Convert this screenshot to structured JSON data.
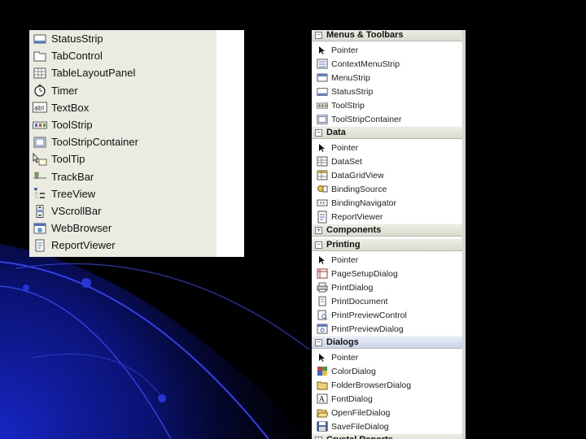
{
  "left_panel": {
    "items": [
      {
        "label": "StatusStrip",
        "icon": "status-strip-icon"
      },
      {
        "label": "TabControl",
        "icon": "tab-control-icon"
      },
      {
        "label": "TableLayoutPanel",
        "icon": "table-layout-panel-icon"
      },
      {
        "label": "Timer",
        "icon": "timer-icon"
      },
      {
        "label": "TextBox",
        "icon": "textbox-icon"
      },
      {
        "label": "ToolStrip",
        "icon": "toolstrip-icon"
      },
      {
        "label": "ToolStripContainer",
        "icon": "toolstrip-container-icon"
      },
      {
        "label": "ToolTip",
        "icon": "tooltip-icon"
      },
      {
        "label": "TrackBar",
        "icon": "trackbar-icon"
      },
      {
        "label": "TreeView",
        "icon": "treeview-icon"
      },
      {
        "label": "VScrollBar",
        "icon": "vscrollbar-icon"
      },
      {
        "label": "WebBrowser",
        "icon": "webbrowser-icon"
      },
      {
        "label": "ReportViewer",
        "icon": "reportviewer-icon"
      }
    ]
  },
  "right_panel": {
    "categories": [
      {
        "label": "Menus & Toolbars",
        "expanded": true,
        "items": [
          {
            "label": "Pointer",
            "icon": "pointer-icon"
          },
          {
            "label": "ContextMenuStrip",
            "icon": "context-menu-strip-icon"
          },
          {
            "label": "MenuStrip",
            "icon": "menu-strip-icon"
          },
          {
            "label": "StatusStrip",
            "icon": "status-strip-icon"
          },
          {
            "label": "ToolStrip",
            "icon": "toolstrip-icon"
          },
          {
            "label": "ToolStripContainer",
            "icon": "toolstrip-container-icon"
          }
        ]
      },
      {
        "label": "Data",
        "expanded": true,
        "items": [
          {
            "label": "Pointer",
            "icon": "pointer-icon"
          },
          {
            "label": "DataSet",
            "icon": "dataset-icon"
          },
          {
            "label": "DataGridView",
            "icon": "datagridview-icon"
          },
          {
            "label": "BindingSource",
            "icon": "binding-source-icon"
          },
          {
            "label": "BindingNavigator",
            "icon": "binding-navigator-icon"
          },
          {
            "label": "ReportViewer",
            "icon": "reportviewer-icon"
          }
        ]
      },
      {
        "label": "Components",
        "expanded": false,
        "items": []
      },
      {
        "label": "Printing",
        "expanded": true,
        "items": [
          {
            "label": "Pointer",
            "icon": "pointer-icon"
          },
          {
            "label": "PageSetupDialog",
            "icon": "page-setup-dialog-icon"
          },
          {
            "label": "PrintDialog",
            "icon": "print-dialog-icon"
          },
          {
            "label": "PrintDocument",
            "icon": "print-document-icon"
          },
          {
            "label": "PrintPreviewControl",
            "icon": "print-preview-control-icon"
          },
          {
            "label": "PrintPreviewDialog",
            "icon": "print-preview-dialog-icon"
          }
        ]
      },
      {
        "label": "Dialogs",
        "expanded": true,
        "active": true,
        "items": [
          {
            "label": "Pointer",
            "icon": "pointer-icon"
          },
          {
            "label": "ColorDialog",
            "icon": "color-dialog-icon"
          },
          {
            "label": "FolderBrowserDialog",
            "icon": "folder-browser-dialog-icon"
          },
          {
            "label": "FontDialog",
            "icon": "font-dialog-icon"
          },
          {
            "label": "OpenFileDialog",
            "icon": "open-file-dialog-icon"
          },
          {
            "label": "SaveFileDialog",
            "icon": "save-file-dialog-icon"
          }
        ]
      },
      {
        "label": "Crystal Reports",
        "expanded": false,
        "items": []
      }
    ]
  },
  "colors": {
    "slide_background": "#000000",
    "arc_blue": "#1e2bd0",
    "panel_background": "#ecebe2",
    "category_background": "#dcdbd0"
  }
}
